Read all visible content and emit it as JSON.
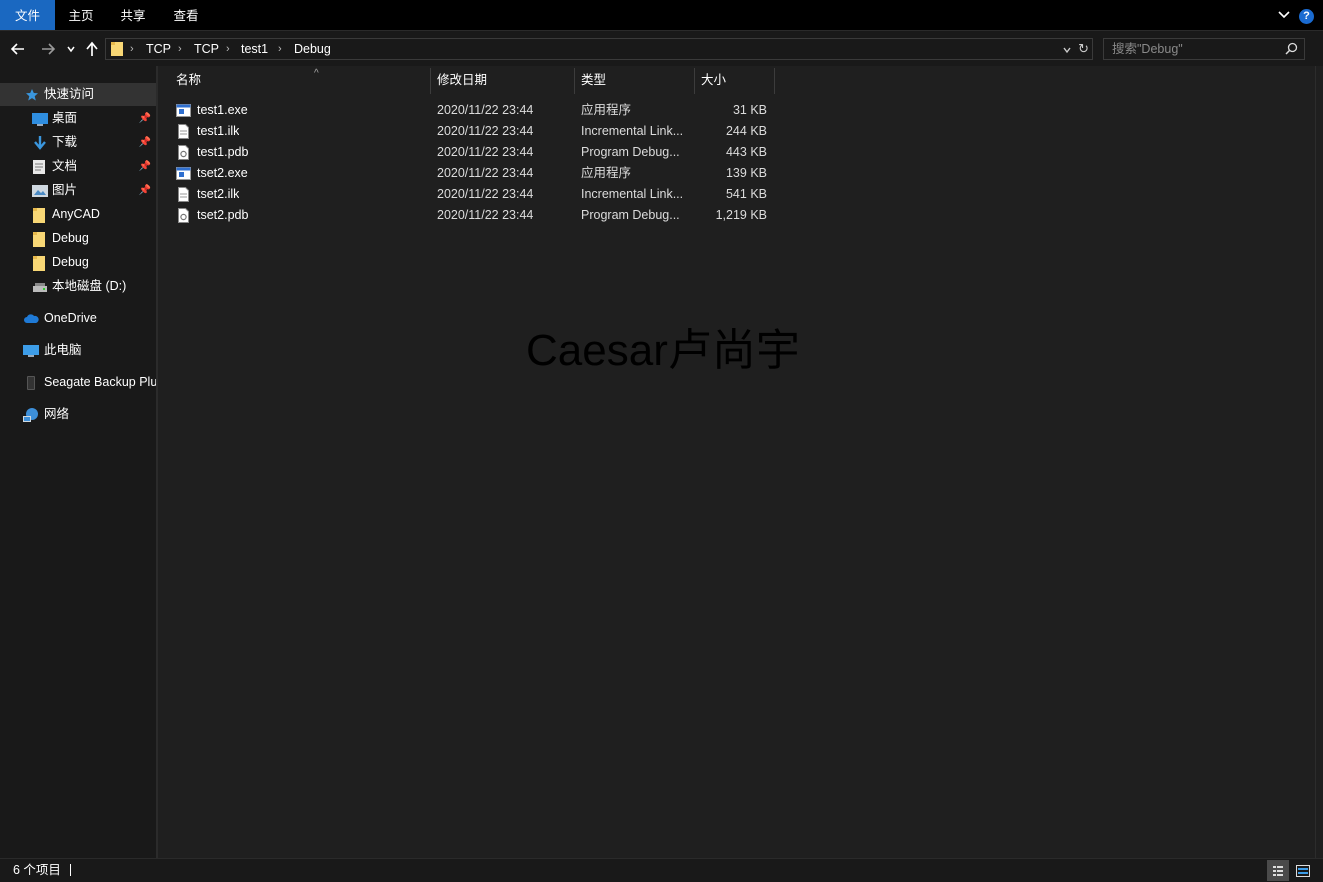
{
  "menu": {
    "file": "文件",
    "home": "主页",
    "share": "共享",
    "view": "查看",
    "help": "?"
  },
  "breadcrumb": [
    "TCP",
    "TCP",
    "test1",
    "Debug"
  ],
  "search": {
    "placeholder": "搜索\"Debug\""
  },
  "sidebar": {
    "quick_access": "快速访问",
    "items": [
      {
        "label": "桌面",
        "icon": "desktop-icon",
        "pinned": true
      },
      {
        "label": "下载",
        "icon": "download-icon",
        "pinned": true
      },
      {
        "label": "文档",
        "icon": "document-icon",
        "pinned": true
      },
      {
        "label": "图片",
        "icon": "picture-icon",
        "pinned": true
      },
      {
        "label": "AnyCAD",
        "icon": "folder-icon",
        "pinned": false
      },
      {
        "label": "Debug",
        "icon": "folder-icon",
        "pinned": false
      },
      {
        "label": "Debug",
        "icon": "folder-icon",
        "pinned": false
      },
      {
        "label": "本地磁盘 (D:)",
        "icon": "drive-icon",
        "pinned": false
      }
    ],
    "onedrive": "OneDrive",
    "this_pc": "此电脑",
    "seagate": "Seagate Backup Plus Drive",
    "network": "网络"
  },
  "columns": {
    "name": "名称",
    "date": "修改日期",
    "type": "类型",
    "size": "大小"
  },
  "files": [
    {
      "name": "test1.exe",
      "date": "2020/11/22 23:44",
      "type": "应用程序",
      "size": "31 KB",
      "icon": "exe-icon"
    },
    {
      "name": "test1.ilk",
      "date": "2020/11/22 23:44",
      "type": "Incremental Link...",
      "size": "244 KB",
      "icon": "file-icon"
    },
    {
      "name": "test1.pdb",
      "date": "2020/11/22 23:44",
      "type": "Program Debug...",
      "size": "443 KB",
      "icon": "pdb-icon"
    },
    {
      "name": "tset2.exe",
      "date": "2020/11/22 23:44",
      "type": "应用程序",
      "size": "139 KB",
      "icon": "exe-icon"
    },
    {
      "name": "tset2.ilk",
      "date": "2020/11/22 23:44",
      "type": "Incremental Link...",
      "size": "541 KB",
      "icon": "file-icon"
    },
    {
      "name": "tset2.pdb",
      "date": "2020/11/22 23:44",
      "type": "Program Debug...",
      "size": "1,219 KB",
      "icon": "pdb-icon"
    }
  ],
  "watermark": "Caesar卢尚宇",
  "status": {
    "count": "6 个项目"
  },
  "colors": {
    "accent": "#1a68c1",
    "folder": "#f8d775",
    "background": "#191919",
    "content_background": "#1f1f1f"
  }
}
